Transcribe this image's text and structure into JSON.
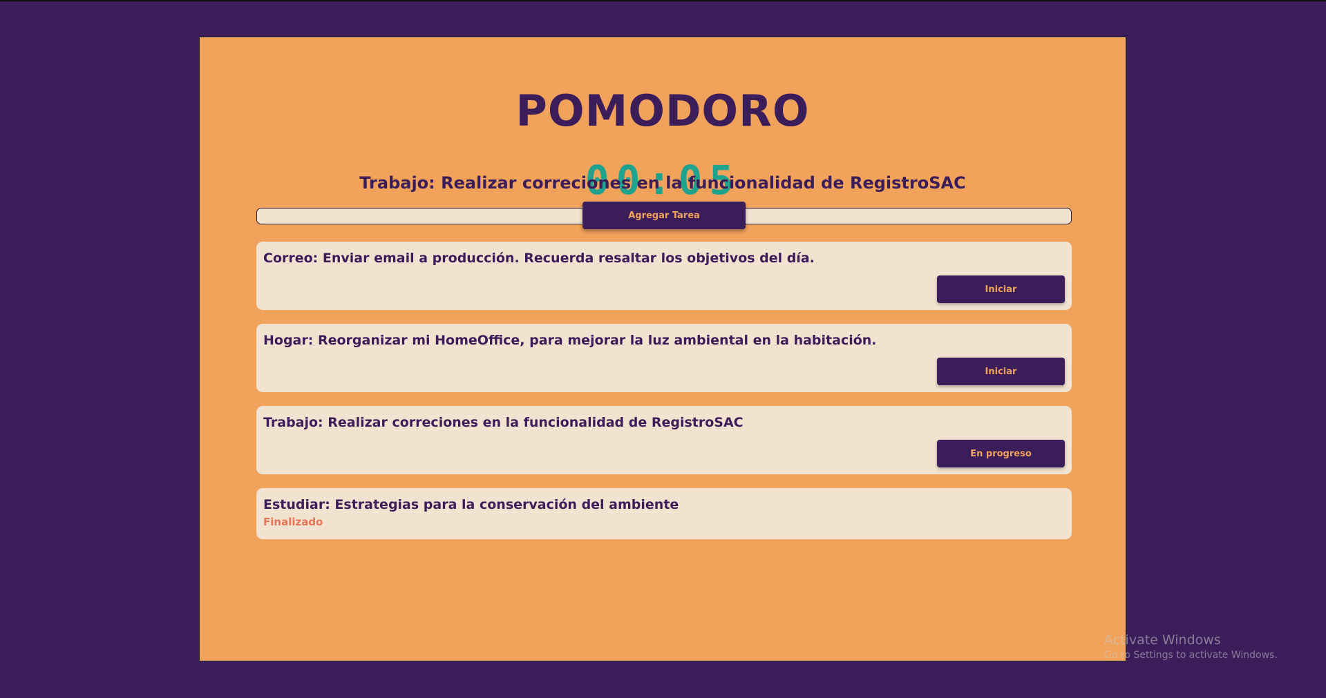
{
  "app": {
    "title": "POMODORO",
    "timer": "00:05",
    "current_task": "Trabajo: Realizar correciones en la funcionalidad de RegistroSAC",
    "progress_fraction": 0.0,
    "add_task_label": "Agregar Tarea"
  },
  "tasks": [
    {
      "text": "Correo: Enviar email a producción. Recuerda resaltar los objetivos del día.",
      "button_label": "Iniciar"
    },
    {
      "text": "Hogar: Reorganizar mi HomeOffice, para mejorar la luz ambiental en la habitación.",
      "button_label": "Iniciar"
    },
    {
      "text": "Trabajo: Realizar correciones en la funcionalidad de RegistroSAC",
      "button_label": "En progreso"
    },
    {
      "text": "Estudiar: Estrategias para la conservación del ambiente",
      "status": "Finalizado"
    }
  ],
  "watermark": {
    "line1": "Activate Windows",
    "line2": "Go to Settings to activate Windows."
  },
  "colors": {
    "background": "#3b1d5a",
    "panel": "#f1a35c",
    "card": "#f2e3d0",
    "timer": "#1fa38f",
    "finished": "#e57455"
  }
}
